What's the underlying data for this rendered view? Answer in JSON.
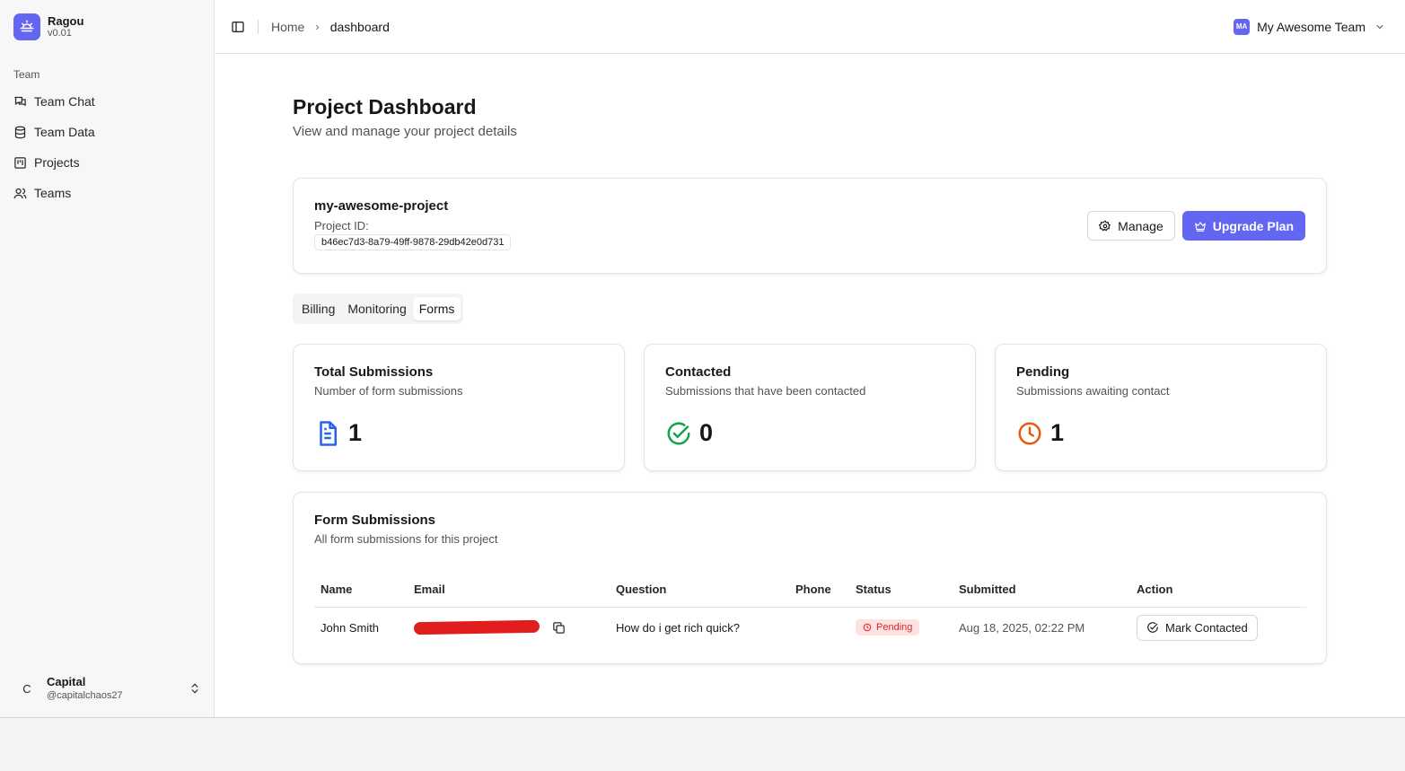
{
  "app": {
    "name": "Ragou",
    "version": "v0.01"
  },
  "sidebar": {
    "group_label": "Team",
    "items": [
      {
        "label": "Team Chat",
        "icon": "chat-icon"
      },
      {
        "label": "Team Data",
        "icon": "database-icon"
      },
      {
        "label": "Projects",
        "icon": "kanban-icon"
      },
      {
        "label": "Teams",
        "icon": "users-icon"
      }
    ],
    "user": {
      "avatar": "C",
      "name": "Capital",
      "handle": "@capitalchaos27"
    }
  },
  "topbar": {
    "breadcrumb": [
      "Home",
      "dashboard"
    ],
    "team": {
      "initials": "MA",
      "name": "My Awesome Team"
    }
  },
  "page": {
    "title": "Project Dashboard",
    "subtitle": "View and manage your project details"
  },
  "project": {
    "name": "my-awesome-project",
    "id_label": "Project ID:",
    "id": "b46ec7d3-8a79-49ff-9878-29db42e0d731",
    "manage_label": "Manage",
    "upgrade_label": "Upgrade Plan"
  },
  "tabs": [
    {
      "label": "Billing"
    },
    {
      "label": "Monitoring"
    },
    {
      "label": "Forms",
      "active": true
    }
  ],
  "stats": [
    {
      "title": "Total Submissions",
      "subtitle": "Number of form submissions",
      "value": "1",
      "icon": "document-icon",
      "color": "#2563eb"
    },
    {
      "title": "Contacted",
      "subtitle": "Submissions that have been contacted",
      "value": "0",
      "icon": "check-circle-icon",
      "color": "#16a34a"
    },
    {
      "title": "Pending",
      "subtitle": "Submissions awaiting contact",
      "value": "1",
      "icon": "clock-icon",
      "color": "#ea580c"
    }
  ],
  "submissions": {
    "title": "Form Submissions",
    "subtitle": "All form submissions for this project",
    "columns": [
      "Name",
      "Email",
      "Question",
      "Phone",
      "Status",
      "Submitted",
      "Action"
    ],
    "rows": [
      {
        "name": "John Smith",
        "email": "",
        "question": "How do i get rich quick?",
        "phone": "",
        "status": "Pending",
        "submitted": "Aug 18, 2025, 02:22 PM",
        "action": "Mark Contacted"
      }
    ]
  },
  "colors": {
    "accent": "#6366f1",
    "pending_bg": "#fee2e2",
    "pending_fg": "#dc2626"
  }
}
